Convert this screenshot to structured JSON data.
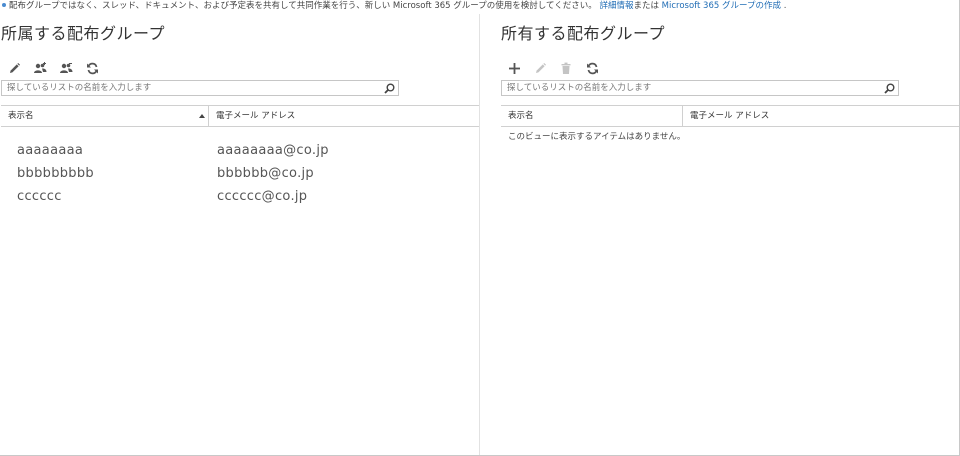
{
  "banner": {
    "text": "配布グループではなく、スレッド、ドキュメント、および予定表を共有して共同作業を行う、新しい Microsoft 365 グループの使用を検討してください。",
    "link_more": "詳細情報",
    "middle": "または",
    "link_create": "Microsoft 365 グループの作成",
    "end": "."
  },
  "member_of": {
    "title": "所属する配布グループ",
    "search_placeholder": "探しているリストの名前を入力します",
    "columns": {
      "name": "表示名",
      "email": "電子メール アドレス"
    },
    "rows": [
      {
        "name": "aaaaaaaa",
        "email": "aaaaaaaa@co.jp"
      },
      {
        "name": "bbbbbbbbb",
        "email": "bbbbbb@co.jp"
      },
      {
        "name": "cccccc",
        "email": "cccccc@co.jp"
      }
    ],
    "toolbar_icons": [
      "pencil-icon",
      "join-group-icon",
      "leave-group-icon",
      "refresh-icon"
    ]
  },
  "owned": {
    "title": "所有する配布グループ",
    "search_placeholder": "探しているリストの名前を入力します",
    "columns": {
      "name": "表示名",
      "email": "電子メール アドレス"
    },
    "empty_message": "このビューに表示するアイテムはありません。",
    "toolbar_icons": [
      "plus-icon",
      "pencil-icon",
      "trash-icon",
      "refresh-icon"
    ]
  },
  "colors": {
    "link": "#1f6cb5",
    "icon_active": "#555555",
    "icon_disabled": "#c4c4c4",
    "border": "#d0d0d0"
  }
}
